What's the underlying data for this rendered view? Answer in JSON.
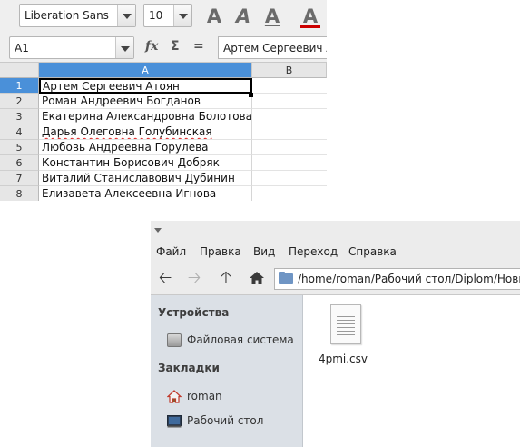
{
  "spreadsheet": {
    "font_name": "Liberation Sans",
    "font_size": "10",
    "format_buttons": [
      "A",
      "A",
      "A",
      "A"
    ],
    "name_box": "A1",
    "formula_icons": [
      "fx",
      "Σ",
      "="
    ],
    "formula_value": "Артем Сергеевич Атоян",
    "columns": [
      "A",
      "B"
    ],
    "rows": [
      {
        "num": "1",
        "value": "Артем Сергеевич Атоян"
      },
      {
        "num": "2",
        "value": "Роман Андреевич Богданов"
      },
      {
        "num": "3",
        "value": "Екатерина Александровна Болотова"
      },
      {
        "num": "4",
        "value": "Дарья Олеговна Голубинская"
      },
      {
        "num": "5",
        "value": "Любовь Андреевна Горулева"
      },
      {
        "num": "6",
        "value": "Константин Борисович Добряк"
      },
      {
        "num": "7",
        "value": "Виталий Станиславович Дубинин"
      },
      {
        "num": "8",
        "value": "Елизавета Алексеевна Игнова"
      }
    ],
    "selection_color": "#4a90d9"
  },
  "file_manager": {
    "menu": [
      "Файл",
      "Правка",
      "Вид",
      "Переход",
      "Справка"
    ],
    "nav_icons": [
      "back-arrow-icon",
      "forward-arrow-icon",
      "up-arrow-icon",
      "home-icon"
    ],
    "path": "/home/roman/Рабочий стол/Diplom/Новы",
    "sidebar": {
      "devices_header": "Устройства",
      "devices": [
        {
          "label": "Файловая система",
          "icon": "disk-icon"
        }
      ],
      "bookmarks_header": "Закладки",
      "bookmarks": [
        {
          "label": "roman",
          "icon": "home-icon"
        },
        {
          "label": "Рабочий стол",
          "icon": "desktop-icon"
        }
      ]
    },
    "files": [
      {
        "name": "4pmi.csv",
        "icon": "document-icon"
      }
    ]
  }
}
